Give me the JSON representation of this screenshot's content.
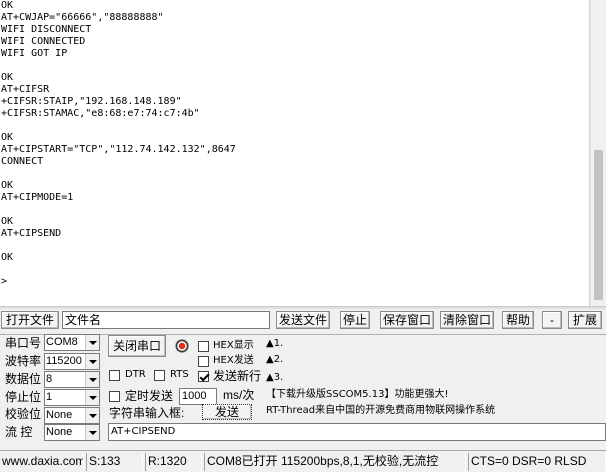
{
  "receive": {
    "lines": [
      "OK",
      "AT+CWJAP=\"66666\",\"88888888\"",
      "WIFI DISCONNECT",
      "WIFI CONNECTED",
      "WIFI GOT IP",
      "",
      "OK",
      "AT+CIFSR",
      "+CIFSR:STAIP,\"192.168.148.189\"",
      "+CIFSR:STAMAC,\"e8:68:e7:74:c7:4b\"",
      "",
      "OK",
      "AT+CIPSTART=\"TCP\",\"112.74.142.132\",8647",
      "CONNECT",
      "",
      "OK",
      "AT+CIPMODE=1",
      "",
      "OK",
      "AT+CIPSEND",
      "",
      "OK",
      "",
      ">"
    ]
  },
  "toolbar": {
    "open_file": "打开文件",
    "filename_value": "文件名",
    "send_file": "发送文件",
    "stop": "停止",
    "save_window": "保存窗口",
    "clear_window": "清除窗口",
    "help": "帮助",
    "minus": "-",
    "expand": "扩展"
  },
  "serial": {
    "port_label": "串口号",
    "port_value": "COM8",
    "baud_label": "波特率",
    "baud_value": "115200",
    "databits_label": "数据位",
    "databits_value": "8",
    "stopbits_label": "停止位",
    "stopbits_value": "1",
    "parity_label": "校验位",
    "parity_value": "None",
    "flow_label": "流 控",
    "flow_value": "None",
    "close_port": "关闭串口",
    "dtr": "DTR",
    "rts": "RTS",
    "hex_display": "HEX显示",
    "hex_send": "HEX发送",
    "send_newline": "发送新行",
    "timed_send": "定时发送",
    "interval_value": "1000",
    "interval_unit": "ms/次",
    "input_label": "字符串输入框:",
    "send_button": "发送",
    "input_value": "AT+CIPSEND"
  },
  "presets": {
    "p1": "▲1.",
    "p2": "▲2.",
    "p3": "▲3."
  },
  "ads": {
    "line1": "【下载升级版SSCOM5.13】功能更强大!",
    "line2": "RT-Thread来自中国的开源免费商用物联网操作系统"
  },
  "status": {
    "website": "www.daxia.com",
    "sent": "S:133",
    "received": "R:1320",
    "port_state": "COM8已打开  115200bps,8,1,无校验,无流控",
    "lines": "CTS=0 DSR=0 RLSD"
  },
  "colors": {
    "led": "#e03020"
  },
  "checks": {
    "hex_display": false,
    "hex_send": false,
    "send_newline": true,
    "dtr": false,
    "rts": false,
    "timed_send": false
  }
}
